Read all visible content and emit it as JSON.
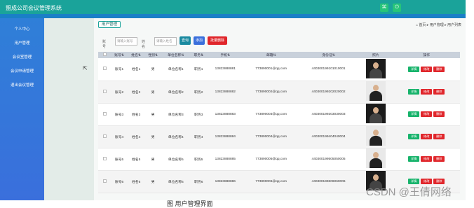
{
  "app": {
    "title": "盟成公司会议管理系统"
  },
  "topbar": {
    "icon1": "⌘",
    "icon2": "⏻"
  },
  "sidebar": {
    "items": [
      {
        "label": "个人中心"
      },
      {
        "label": "用户管理"
      },
      {
        "label": "会议室管理"
      },
      {
        "label": "会议申请管理"
      },
      {
        "label": "退出会议管理"
      }
    ]
  },
  "page": {
    "tab_label": "用户管理",
    "breadcrumb": "⌂ 首页 ▸ 用户管理 ▸ 用户列表"
  },
  "search": {
    "label1": "账号",
    "placeholder1": "请输入账号",
    "label2": "姓名",
    "placeholder2": "请输入姓名",
    "query_label": "查询",
    "add_label": "添加",
    "batch_delete_label": "批量删除"
  },
  "table": {
    "headers": [
      "",
      "账号⇅",
      "姓名⇅",
      "性别⇅",
      "单位名称⇅",
      "职务⇅",
      "手机⇅",
      "邮箱⇅",
      "身份证⇅",
      "照片",
      "操作"
    ],
    "rows": [
      {
        "account": "账号1",
        "name": "姓名1",
        "gender": "男",
        "unit": "单位名称1",
        "title": "职务1",
        "phone": "13823888881",
        "email": "773890001@qq.com",
        "id_card": "440300199101010001"
      },
      {
        "account": "账号2",
        "name": "姓名2",
        "gender": "男",
        "unit": "单位名称2",
        "title": "职务2",
        "phone": "13823888882",
        "email": "773890002@qq.com",
        "id_card": "440300199202020002"
      },
      {
        "account": "账号3",
        "name": "姓名3",
        "gender": "男",
        "unit": "单位名称3",
        "title": "职务3",
        "phone": "13823888883",
        "email": "773890003@qq.com",
        "id_card": "440300199303030003"
      },
      {
        "account": "账号4",
        "name": "姓名4",
        "gender": "男",
        "unit": "单位名称4",
        "title": "职务4",
        "phone": "13823888884",
        "email": "773890004@qq.com",
        "id_card": "440300199404040004"
      },
      {
        "account": "账号5",
        "name": "姓名5",
        "gender": "男",
        "unit": "单位名称5",
        "title": "职务5",
        "phone": "13823888885",
        "email": "773890005@qq.com",
        "id_card": "440300199505050005"
      },
      {
        "account": "账号6",
        "name": "姓名6",
        "gender": "男",
        "unit": "单位名称6",
        "title": "职务6",
        "phone": "13823888886",
        "email": "773890006@qq.com",
        "id_card": "440300199606060006"
      }
    ],
    "op_labels": {
      "detail": "详情",
      "edit": "修改",
      "delete": "删除"
    }
  },
  "watermark": "CSDN @王倩网络",
  "caption": "图 用户管理界面"
}
